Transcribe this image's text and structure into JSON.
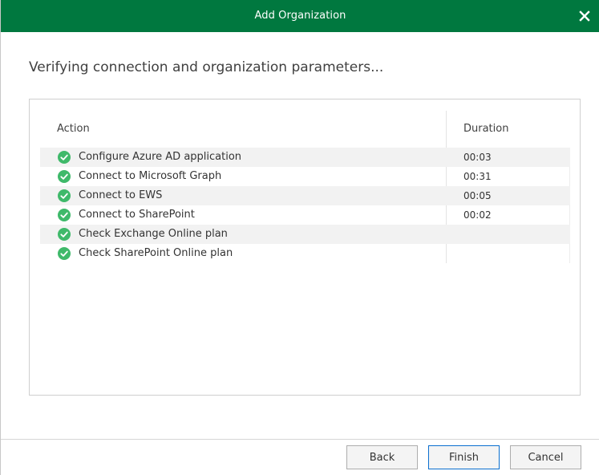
{
  "window": {
    "title": "Add Organization",
    "close_icon": "close-icon",
    "accent_color": "#00783f"
  },
  "main": {
    "heading": "Verifying connection and organization parameters..."
  },
  "table": {
    "columns": {
      "action": "Action",
      "duration": "Duration"
    },
    "status_icon": "success-check-icon",
    "status_color": "#3fb96a",
    "rows": [
      {
        "action": "Configure Azure AD application",
        "duration": "00:03"
      },
      {
        "action": "Connect to Microsoft Graph",
        "duration": "00:31"
      },
      {
        "action": "Connect to EWS",
        "duration": "00:05"
      },
      {
        "action": "Connect to SharePoint",
        "duration": "00:02"
      },
      {
        "action": "Check Exchange Online plan",
        "duration": ""
      },
      {
        "action": "Check SharePoint Online plan",
        "duration": ""
      }
    ]
  },
  "footer": {
    "back_label": "Back",
    "finish_label": "Finish",
    "cancel_label": "Cancel"
  }
}
